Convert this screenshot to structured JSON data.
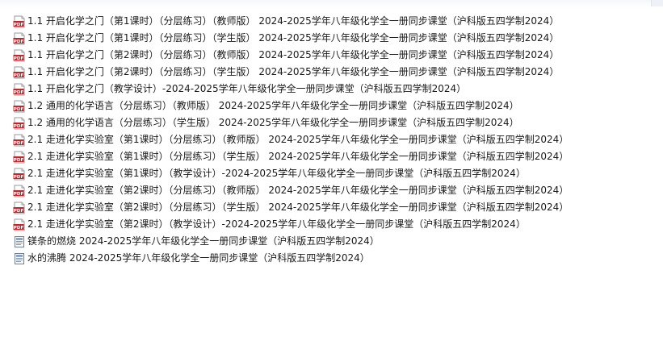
{
  "icons": {
    "pdf": "pdf-file-icon",
    "generic": "document-file-icon"
  },
  "colors": {
    "pdf_icon": "#c1272d",
    "text": "#1a1a1a",
    "background": "#ffffff"
  },
  "files": [
    {
      "type": "pdf",
      "name": "1.1 开启化学之门（第1课时）（分层练习）（教师版） 2024-2025学年八年级化学全一册同步课堂（沪科版五四学制2024）"
    },
    {
      "type": "pdf",
      "name": "1.1 开启化学之门（第1课时）（分层练习）（学生版） 2024-2025学年八年级化学全一册同步课堂（沪科版五四学制2024）"
    },
    {
      "type": "pdf",
      "name": "1.1 开启化学之门（第2课时）（分层练习）（教师版） 2024-2025学年八年级化学全一册同步课堂（沪科版五四学制2024）"
    },
    {
      "type": "pdf",
      "name": "1.1 开启化学之门（第2课时）（分层练习）（学生版） 2024-2025学年八年级化学全一册同步课堂（沪科版五四学制2024）"
    },
    {
      "type": "pdf",
      "name": "1.1 开启化学之门（教学设计）-2024-2025学年八年级化学全一册同步课堂（沪科版五四学制2024）"
    },
    {
      "type": "pdf",
      "name": "1.2 通用的化学语言（分层练习）（教师版） 2024-2025学年八年级化学全一册同步课堂（沪科版五四学制2024）"
    },
    {
      "type": "pdf",
      "name": "1.2 通用的化学语言（分层练习）（学生版） 2024-2025学年八年级化学全一册同步课堂（沪科版五四学制2024）"
    },
    {
      "type": "pdf",
      "name": "2.1 走进化学实验室（第1课时）（分层练习）（教师版） 2024-2025学年八年级化学全一册同步课堂（沪科版五四学制2024）"
    },
    {
      "type": "pdf",
      "name": "2.1 走进化学实验室（第1课时）（分层练习）（学生版） 2024-2025学年八年级化学全一册同步课堂（沪科版五四学制2024）"
    },
    {
      "type": "pdf",
      "name": "2.1 走进化学实验室（第1课时）（教学设计）-2024-2025学年八年级化学全一册同步课堂（沪科版五四学制2024）"
    },
    {
      "type": "pdf",
      "name": "2.1 走进化学实验室（第2课时）（分层练习）（教师版） 2024-2025学年八年级化学全一册同步课堂（沪科版五四学制2024）"
    },
    {
      "type": "pdf",
      "name": "2.1 走进化学实验室（第2课时）（分层练习）（学生版） 2024-2025学年八年级化学全一册同步课堂（沪科版五四学制2024）"
    },
    {
      "type": "pdf",
      "name": "2.1 走进化学实验室（第2课时）（教学设计）-2024-2025学年八年级化学全一册同步课堂（沪科版五四学制2024）"
    },
    {
      "type": "generic",
      "name": "镁条的燃烧 2024-2025学年八年级化学全一册同步课堂（沪科版五四学制2024）"
    },
    {
      "type": "generic",
      "name": "水的沸腾 2024-2025学年八年级化学全一册同步课堂（沪科版五四学制2024）"
    }
  ]
}
